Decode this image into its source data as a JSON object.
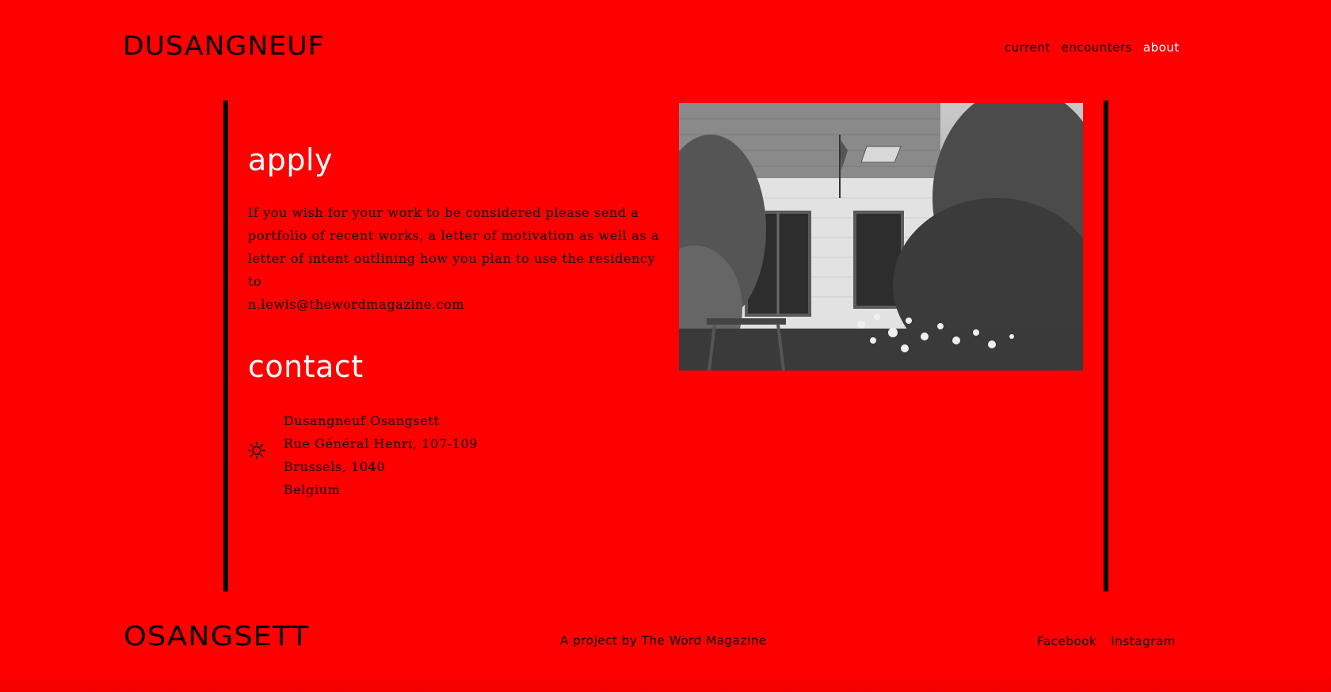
{
  "header": {
    "logo": "DUSANGNEUF",
    "nav": [
      {
        "label": "current"
      },
      {
        "label": "encounters"
      },
      {
        "label": "about",
        "active": true
      }
    ]
  },
  "apply": {
    "title": "apply",
    "lines": [
      "If you wish for your work to be considered please send a",
      "portfolio of recent works, a letter of motivation as well as a",
      "letter of intent outlining how you plan to use the residency to"
    ],
    "email": "n.lewis@thewordmagazine.com"
  },
  "contact": {
    "title": "contact",
    "icon": "sun-icon",
    "address": [
      "Dusangneuf Osangsett",
      "Rue Général Henri, 107-109",
      "Brussels, 1040",
      "Belgium"
    ]
  },
  "photo": {
    "icon": "building-garden-photo"
  },
  "footer": {
    "logo": "OSANGSETT",
    "credit": "A project by The Word Magazine",
    "social": [
      "Facebook",
      "Instagram"
    ]
  },
  "colors": {
    "background": "#ff0000",
    "text": "#000000",
    "highlight": "#ffffff"
  }
}
